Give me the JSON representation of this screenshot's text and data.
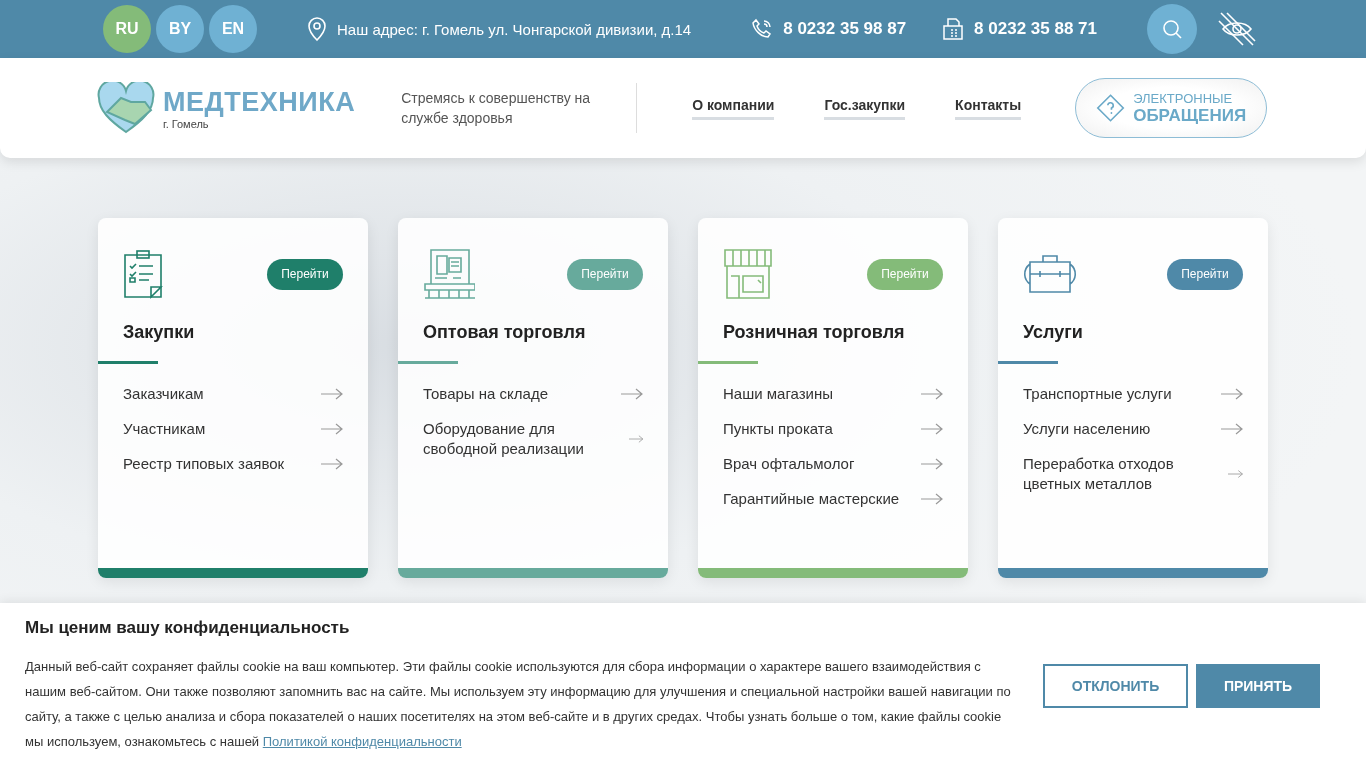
{
  "languages": [
    {
      "label": "RU",
      "selected": true
    },
    {
      "label": "BY",
      "selected": false
    },
    {
      "label": "EN",
      "selected": false
    }
  ],
  "address": "Наш адрес: г. Гомель ул. Чонгарской дивизии, д.14",
  "phone": "8 0232 35 98 87",
  "fax": "8 0232 35 88 71",
  "logo": {
    "name": "МЕДТЕХНИКА",
    "city": "г. Гомель"
  },
  "slogan": "Стремясь к совершенству на службе здоровья",
  "nav": [
    "О компании",
    "Гос.закупки",
    "Контакты"
  ],
  "appeal_button": {
    "line_1": "ЭЛЕКТРОННЫЕ",
    "line_2": "ОБРАЩЕНИЯ"
  },
  "cards": [
    {
      "kind": "clipboard",
      "color": "#1f7f6a",
      "title": "Закупки",
      "button": "Перейти",
      "links": [
        "Заказчикам",
        "Участникам",
        "Реестр типовых заявок"
      ]
    },
    {
      "kind": "warehouse",
      "color": "#67aa9c",
      "title": "Оптовая торговля",
      "button": "Перейти",
      "links": [
        "Товары на складе",
        "Оборудование для свободной реализации"
      ]
    },
    {
      "kind": "shop",
      "color": "#84bb79",
      "title": "Розничная торговля",
      "button": "Перейти",
      "links": [
        "Наши магазины",
        "Пункты проката",
        "Врач офтальмолог",
        "Гарантийные мастерские"
      ]
    },
    {
      "kind": "bag",
      "color": "#4f89a8",
      "title": "Услуги",
      "button": "Перейти",
      "links": [
        "Транспортные услуги",
        "Услуги населению",
        "Переработка отходов цветных металлов"
      ]
    }
  ],
  "cookie": {
    "title": "Мы ценим вашу конфиденциальность",
    "text": "Данный веб-сайт сохраняет файлы cookie на ваш компьютер. Эти файлы cookie используются для сбора информации о характере вашего взаимодействия с нашим веб-сайтом. Они также позволяют запомнить вас на сайте. Мы используем эту информацию для улучшения и специальной настройки вашей навигации по сайту, а также с целью анализа и сбора показателей о наших посетителях на этом веб-сайте и в других средах. Чтобы узнать больше о том, какие файлы cookie мы используем, ознакомьтесь с нашей",
    "link": "Политикой конфиденциальности",
    "decline": "ОТКЛОНИТЬ",
    "accept": "ПРИНЯТЬ"
  }
}
